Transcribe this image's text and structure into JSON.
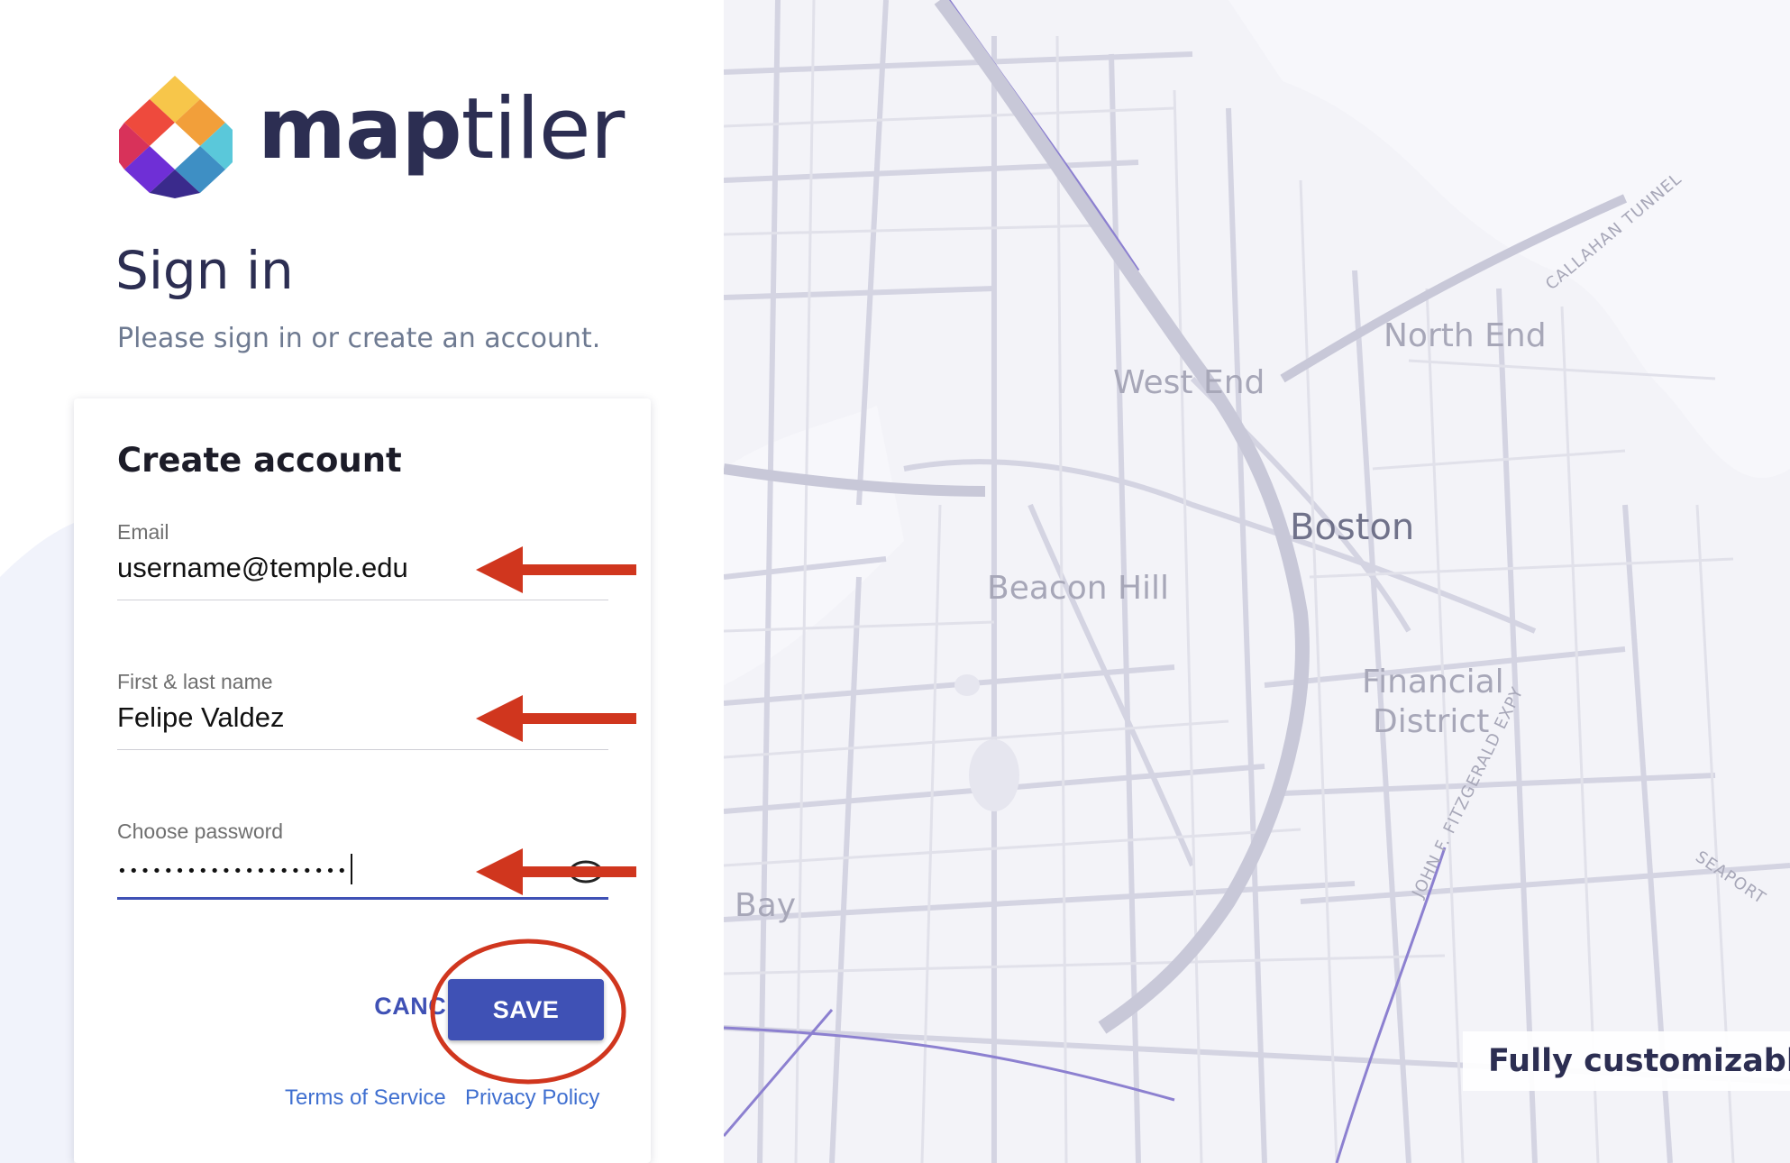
{
  "brand": {
    "name_bold": "map",
    "name_light": "tiler"
  },
  "signin": {
    "title": "Sign in",
    "subtitle": "Please sign in or create an account."
  },
  "form": {
    "title": "Create account",
    "email_label": "Email",
    "email_value": "username@temple.edu",
    "name_label": "First & last name",
    "name_value": "Felipe Valdez",
    "password_label": "Choose password",
    "password_masked": "••••••••••••••••••••",
    "cancel_label": "CANCEL",
    "save_label": "SAVE",
    "terms_label": "Terms of Service",
    "privacy_label": "Privacy Policy"
  },
  "map": {
    "labels": {
      "west_end": "West End",
      "north_end": "North End",
      "boston": "Boston",
      "beacon_hill": "Beacon Hill",
      "financial": "Financial",
      "district": "District",
      "bay": "Bay",
      "callahan": "CALLAHAN TUNNEL",
      "fitzgerald": "JOHN F. FITZGERALD EXPY",
      "seaport": "SEAPORT"
    },
    "badge": "Fully customizable"
  },
  "colors": {
    "accent": "#3f51b5",
    "annotation": "#d0361e",
    "link": "#3f6fd0",
    "map_roads": "#d4d4e2",
    "map_rail": "#8c80d0"
  },
  "icons": {
    "eye": "eye-icon",
    "arrow": "arrow-left-icon"
  }
}
